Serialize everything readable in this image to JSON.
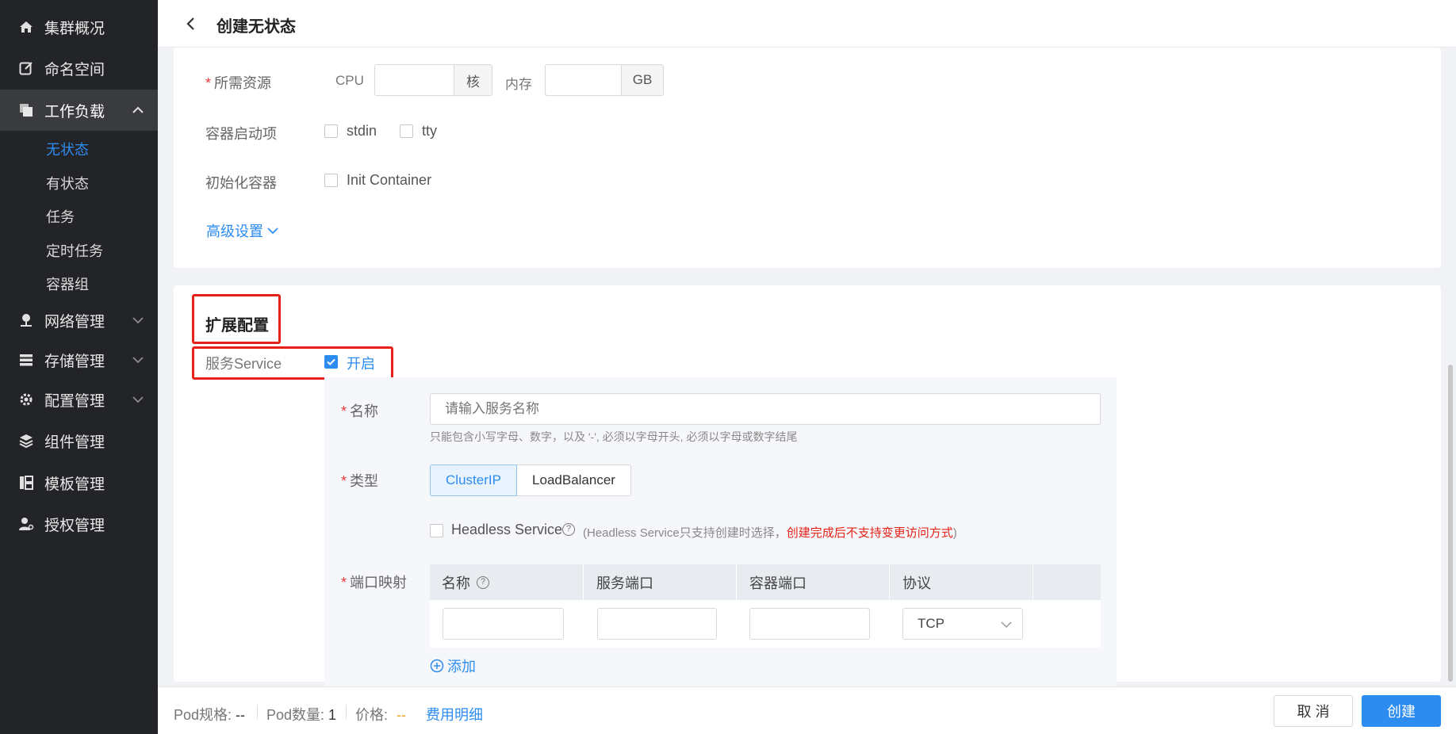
{
  "sidebar": {
    "items": [
      {
        "label": "集群概况",
        "icon": "home-icon"
      },
      {
        "label": "命名空间",
        "icon": "edit-icon"
      },
      {
        "label": "工作负载",
        "icon": "copy-icon"
      },
      {
        "label": "网络管理",
        "icon": "network-icon"
      },
      {
        "label": "存储管理",
        "icon": "storage-icon"
      },
      {
        "label": "配置管理",
        "icon": "gear-icon"
      },
      {
        "label": "组件管理",
        "icon": "layers-icon"
      },
      {
        "label": "模板管理",
        "icon": "template-icon"
      },
      {
        "label": "授权管理",
        "icon": "user-key-icon"
      }
    ],
    "workload_sub": [
      "无状态",
      "有状态",
      "任务",
      "定时任务",
      "容器组"
    ]
  },
  "header": {
    "title": "创建无状态"
  },
  "resources": {
    "label": "所需资源",
    "cpu_label": "CPU",
    "cpu_unit": "核",
    "memory_label": "内存",
    "memory_unit": "GB",
    "cpu_value": "",
    "memory_value": ""
  },
  "startup": {
    "label": "容器启动项",
    "options": [
      "stdin",
      "tty"
    ]
  },
  "init_container": {
    "label": "初始化容器",
    "option": "Init Container"
  },
  "advanced": {
    "label": "高级设置"
  },
  "extension": {
    "title": "扩展配置",
    "service_label": "服务Service",
    "service_toggle": "开启",
    "service_enabled": true
  },
  "service": {
    "name_label": "名称",
    "name_placeholder": "请输入服务名称",
    "name_value": "",
    "name_hint": "只能包含小写字母、数字，以及 '-', 必须以字母开头, 必须以字母或数字结尾",
    "type_label": "类型",
    "types": [
      "ClusterIP",
      "LoadBalancer"
    ],
    "selected_type": "ClusterIP",
    "headless_label": "Headless Service",
    "headless_hint_prefix": "(Headless Service只支持创建时选择，",
    "headless_hint_warn": "创建完成后不支持变更访问方式",
    "headless_hint_suffix": ")",
    "port_label": "端口映射",
    "port_columns": [
      "名称",
      "服务端口",
      "容器端口",
      "协议"
    ],
    "port_rows": [
      {
        "name": "",
        "service_port": "",
        "container_port": "",
        "protocol": "TCP"
      }
    ],
    "add_label": "添加"
  },
  "footer": {
    "pod_spec_label": "Pod规格:",
    "pod_spec_value": "--",
    "pod_count_label": "Pod数量:",
    "pod_count_value": "1",
    "price_label": "价格:",
    "price_value": "--",
    "cost_link": "费用明细",
    "cancel": "取 消",
    "create": "创建"
  },
  "colors": {
    "sidebar_bg": "#232427",
    "accent": "#2d8cf0",
    "danger": "#e62117",
    "price": "#f5a623"
  }
}
